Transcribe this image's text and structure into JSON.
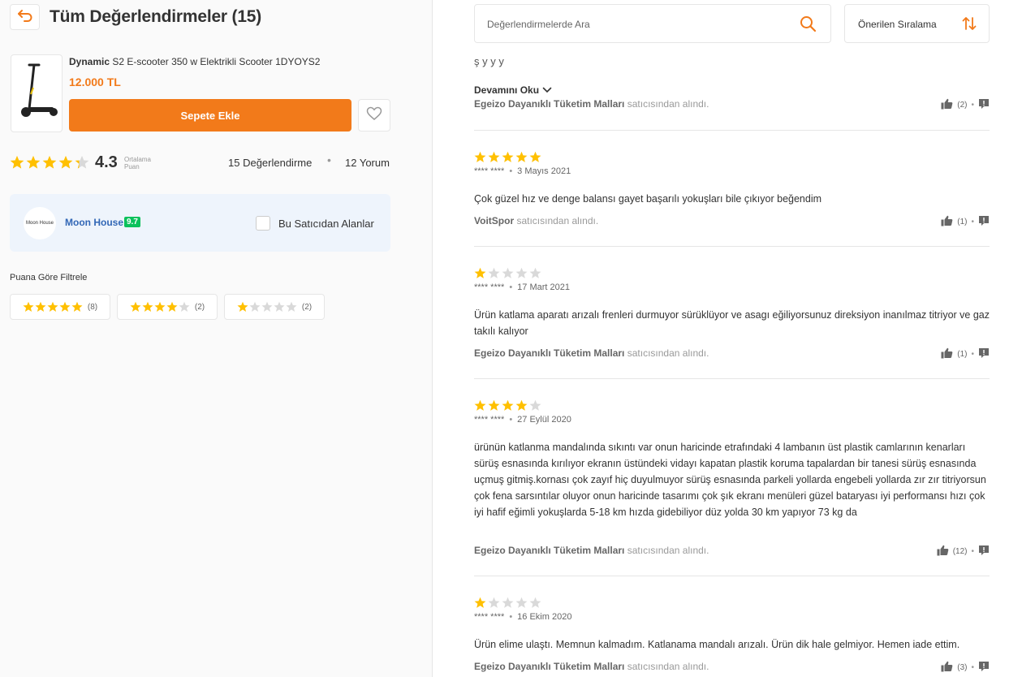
{
  "header": {
    "title": "Tüm Değerlendirmeler (15)"
  },
  "product": {
    "brand": "Dynamic",
    "name": "S2 E-scooter 350 w Elektrikli Scooter 1DYOYS2",
    "price": "12.000 TL",
    "add_to_cart": "Sepete Ekle"
  },
  "summary": {
    "average": "4.3",
    "average_label_1": "Ortalama",
    "average_label_2": "Puan",
    "average_stars": 4.3,
    "rating_count": "15 Değerlendirme",
    "separator": "•",
    "comment_count": "12 Yorum"
  },
  "seller": {
    "logo_text": "Moon House",
    "name": "Moon House",
    "score": "9.7",
    "filter_label": "Bu Satıcıdan Alanlar"
  },
  "filters": {
    "title": "Puana Göre Filtrele",
    "items": [
      {
        "stars": 5,
        "count": "(8)"
      },
      {
        "stars": 4,
        "count": "(2)"
      },
      {
        "stars": 1,
        "count": "(2)"
      }
    ]
  },
  "search": {
    "placeholder": "Değerlendirmelerde Ara"
  },
  "sort": {
    "label": "Önerilen Sıralama"
  },
  "first_partial": {
    "clipped_text": "ş  y  y  y",
    "read_more": "Devamını Oku",
    "seller_name": "Egeizo Dayanıklı Tüketim Malları",
    "seller_suffix": "satıcısından alındı.",
    "likes": "(2)"
  },
  "reviews": [
    {
      "stars": 5,
      "user": "**** ****",
      "date": "3 Mayıs 2021",
      "text": "Çok güzel hız ve denge balansı gayet başarılı yokuşları bile çıkıyor beğendim",
      "seller_name": "VoitSpor",
      "seller_suffix": "satıcısından alındı.",
      "likes": "(1)"
    },
    {
      "stars": 1,
      "user": "**** ****",
      "date": "17 Mart 2021",
      "text": "Ürün katlama aparatı arızalı frenleri durmuyor sürüklüyor ve asagı eğiliyorsunuz direksiyon inanılmaz titriyor ve gaz takılı kalıyor",
      "seller_name": "Egeizo Dayanıklı Tüketim Malları",
      "seller_suffix": "satıcısından alındı.",
      "likes": "(1)"
    },
    {
      "stars": 4,
      "user": "**** ****",
      "date": "27 Eylül 2020",
      "text": "ürünün katlanma mandalında sıkıntı var onun haricinde etrafındaki 4 lambanın üst plastik camlarının kenarları sürüş esnasında kırılıyor ekranın üstündeki vidayı kapatan plastik koruma tapalardan bir tanesi sürüş esnasında uçmuş gitmiş.kornası çok zayıf hiç duyulmuyor sürüş esnasında parkeli yollarda engebeli yollarda zır zır titriyorsun çok fena sarsıntılar oluyor onun haricinde tasarımı çok şık ekranı menüleri güzel bataryası iyi performansı hızı çok iyi hafif eğimli yokuşlarda 5-18 km hızda gidebiliyor düz yolda 30 km yapıyor 73 kg da",
      "seller_name": "Egeizo Dayanıklı Tüketim Malları",
      "seller_suffix": "satıcısından alındı.",
      "likes": "(12)"
    },
    {
      "stars": 1,
      "user": "**** ****",
      "date": "16 Ekim 2020",
      "text": "Ürün elime ulaştı. Memnun kalmadım. Katlanama mandalı arızalı. Ürün dik hale gelmiyor. Hemen iade ettim.",
      "seller_name": "Egeizo Dayanıklı Tüketim Malları",
      "seller_suffix": "satıcısından alındı.",
      "likes": "(3)"
    }
  ],
  "colors": {
    "accent": "#f27a1a",
    "star": "#ffc000",
    "star_empty": "#d9d9d9",
    "seller_link": "#3267b6",
    "score_badge": "#0bc15c"
  }
}
